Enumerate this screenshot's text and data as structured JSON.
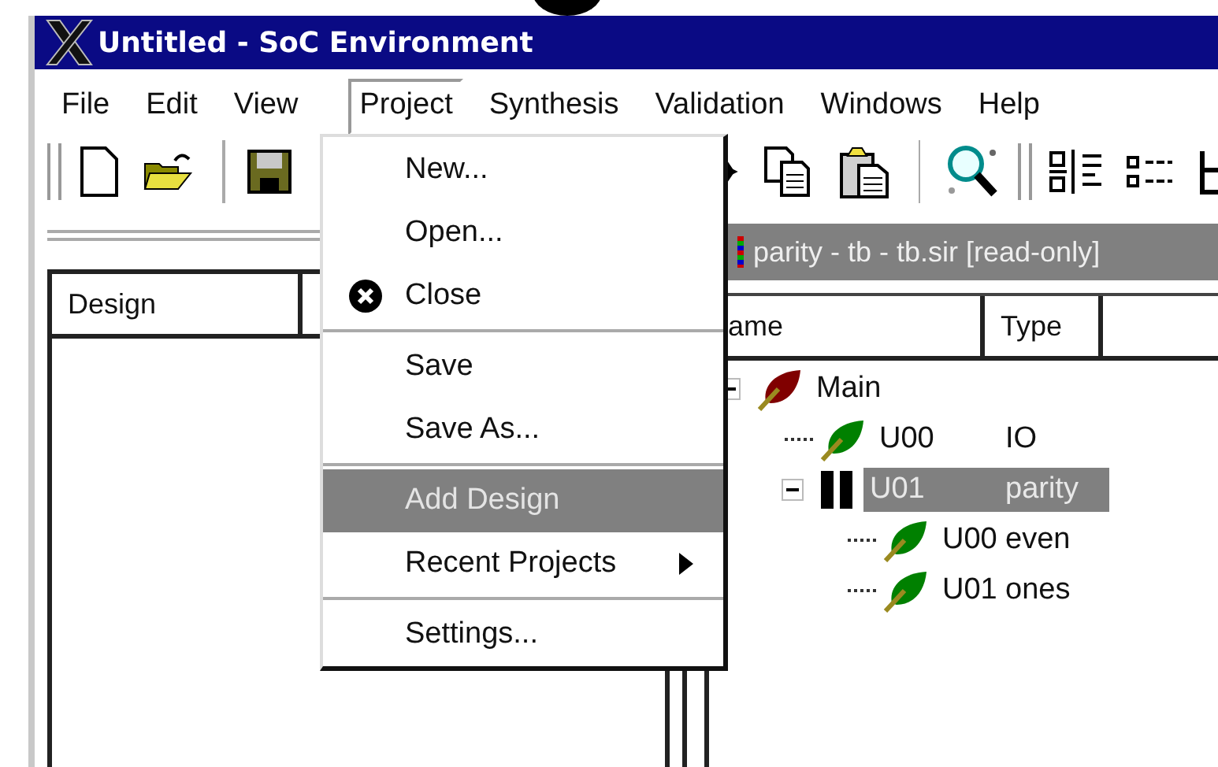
{
  "window": {
    "title": "Untitled - SoC Environment"
  },
  "menus": [
    {
      "label": "File",
      "selected": false
    },
    {
      "label": "Edit",
      "selected": false
    },
    {
      "label": "View",
      "selected": false
    },
    {
      "label": "Project",
      "selected": true
    },
    {
      "label": "Synthesis",
      "selected": false
    },
    {
      "label": "Validation",
      "selected": false
    },
    {
      "label": "Windows",
      "selected": false
    },
    {
      "label": "Help",
      "selected": false
    }
  ],
  "design_panel": {
    "columns": [
      "Design"
    ]
  },
  "document": {
    "caption": "parity - tb - tb.sir [read-only]",
    "columns": [
      "ame",
      "Type"
    ],
    "tree": [
      {
        "name": "Main",
        "kind": "leaf",
        "color": "#800000",
        "expanded": true,
        "selected": false,
        "children": [
          {
            "name": "U00",
            "type": "IO",
            "kind": "leaf",
            "color": "#008000",
            "selected": false
          },
          {
            "name": "U01",
            "type": "parity",
            "kind": "block",
            "color": "#000000",
            "expanded": true,
            "selected": true,
            "children": [
              {
                "name": "U00",
                "type": "even",
                "kind": "leaf",
                "color": "#008000",
                "selected": false
              },
              {
                "name": "U01",
                "type": "ones",
                "kind": "leaf",
                "color": "#008000",
                "selected": false
              }
            ]
          }
        ]
      }
    ]
  },
  "dropdown": {
    "items": [
      {
        "kind": "item",
        "label": "New...",
        "selected": false
      },
      {
        "kind": "item",
        "label": "Open...",
        "selected": false
      },
      {
        "kind": "icon-item",
        "label": "Close",
        "selected": false
      },
      {
        "kind": "separator"
      },
      {
        "kind": "item",
        "label": "Save",
        "selected": false
      },
      {
        "kind": "item",
        "label": "Save As...",
        "selected": false
      },
      {
        "kind": "separator"
      },
      {
        "kind": "item",
        "label": "Add Design",
        "selected": true
      },
      {
        "kind": "submenu",
        "label": "Recent Projects",
        "selected": false
      },
      {
        "kind": "separator"
      },
      {
        "kind": "item",
        "label": "Settings...",
        "selected": false
      }
    ]
  }
}
